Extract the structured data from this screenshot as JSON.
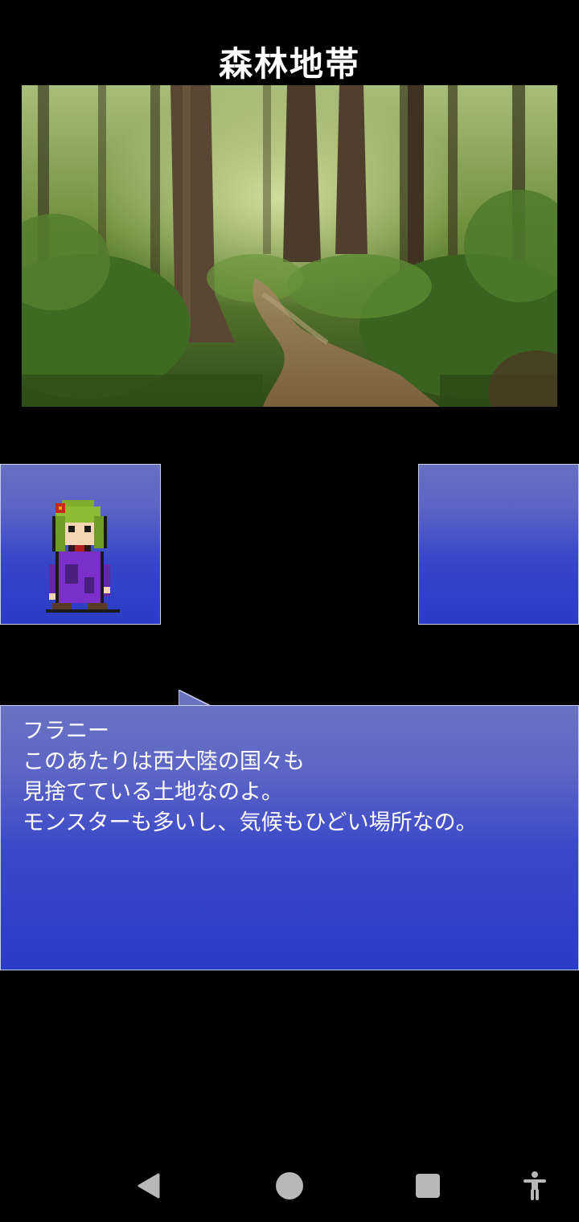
{
  "location": {
    "title": "森林地帯"
  },
  "scene": {
    "image": "forest-path-background"
  },
  "portraits": {
    "left": {
      "character": "franny-sprite"
    },
    "right": {
      "character": ""
    }
  },
  "dialog": {
    "speaker": "フラニー",
    "lines": [
      "このあたりは西大陸の国々も",
      "見捨てている土地なのよ。",
      "モンスターも多いし、気候もひどい場所なの。"
    ]
  },
  "navigation": {
    "back_icon": "triangle-back-icon",
    "home_icon": "circle-home-icon",
    "recents_icon": "square-recents-icon",
    "accessibility_icon": "accessibility-icon"
  },
  "colors": {
    "window_top": "#6a70c0",
    "window_bottom": "#2a3bc7",
    "window_border": "#c9cdf0",
    "text": "#ffffff",
    "nav_icon": "#b8b8b8"
  }
}
